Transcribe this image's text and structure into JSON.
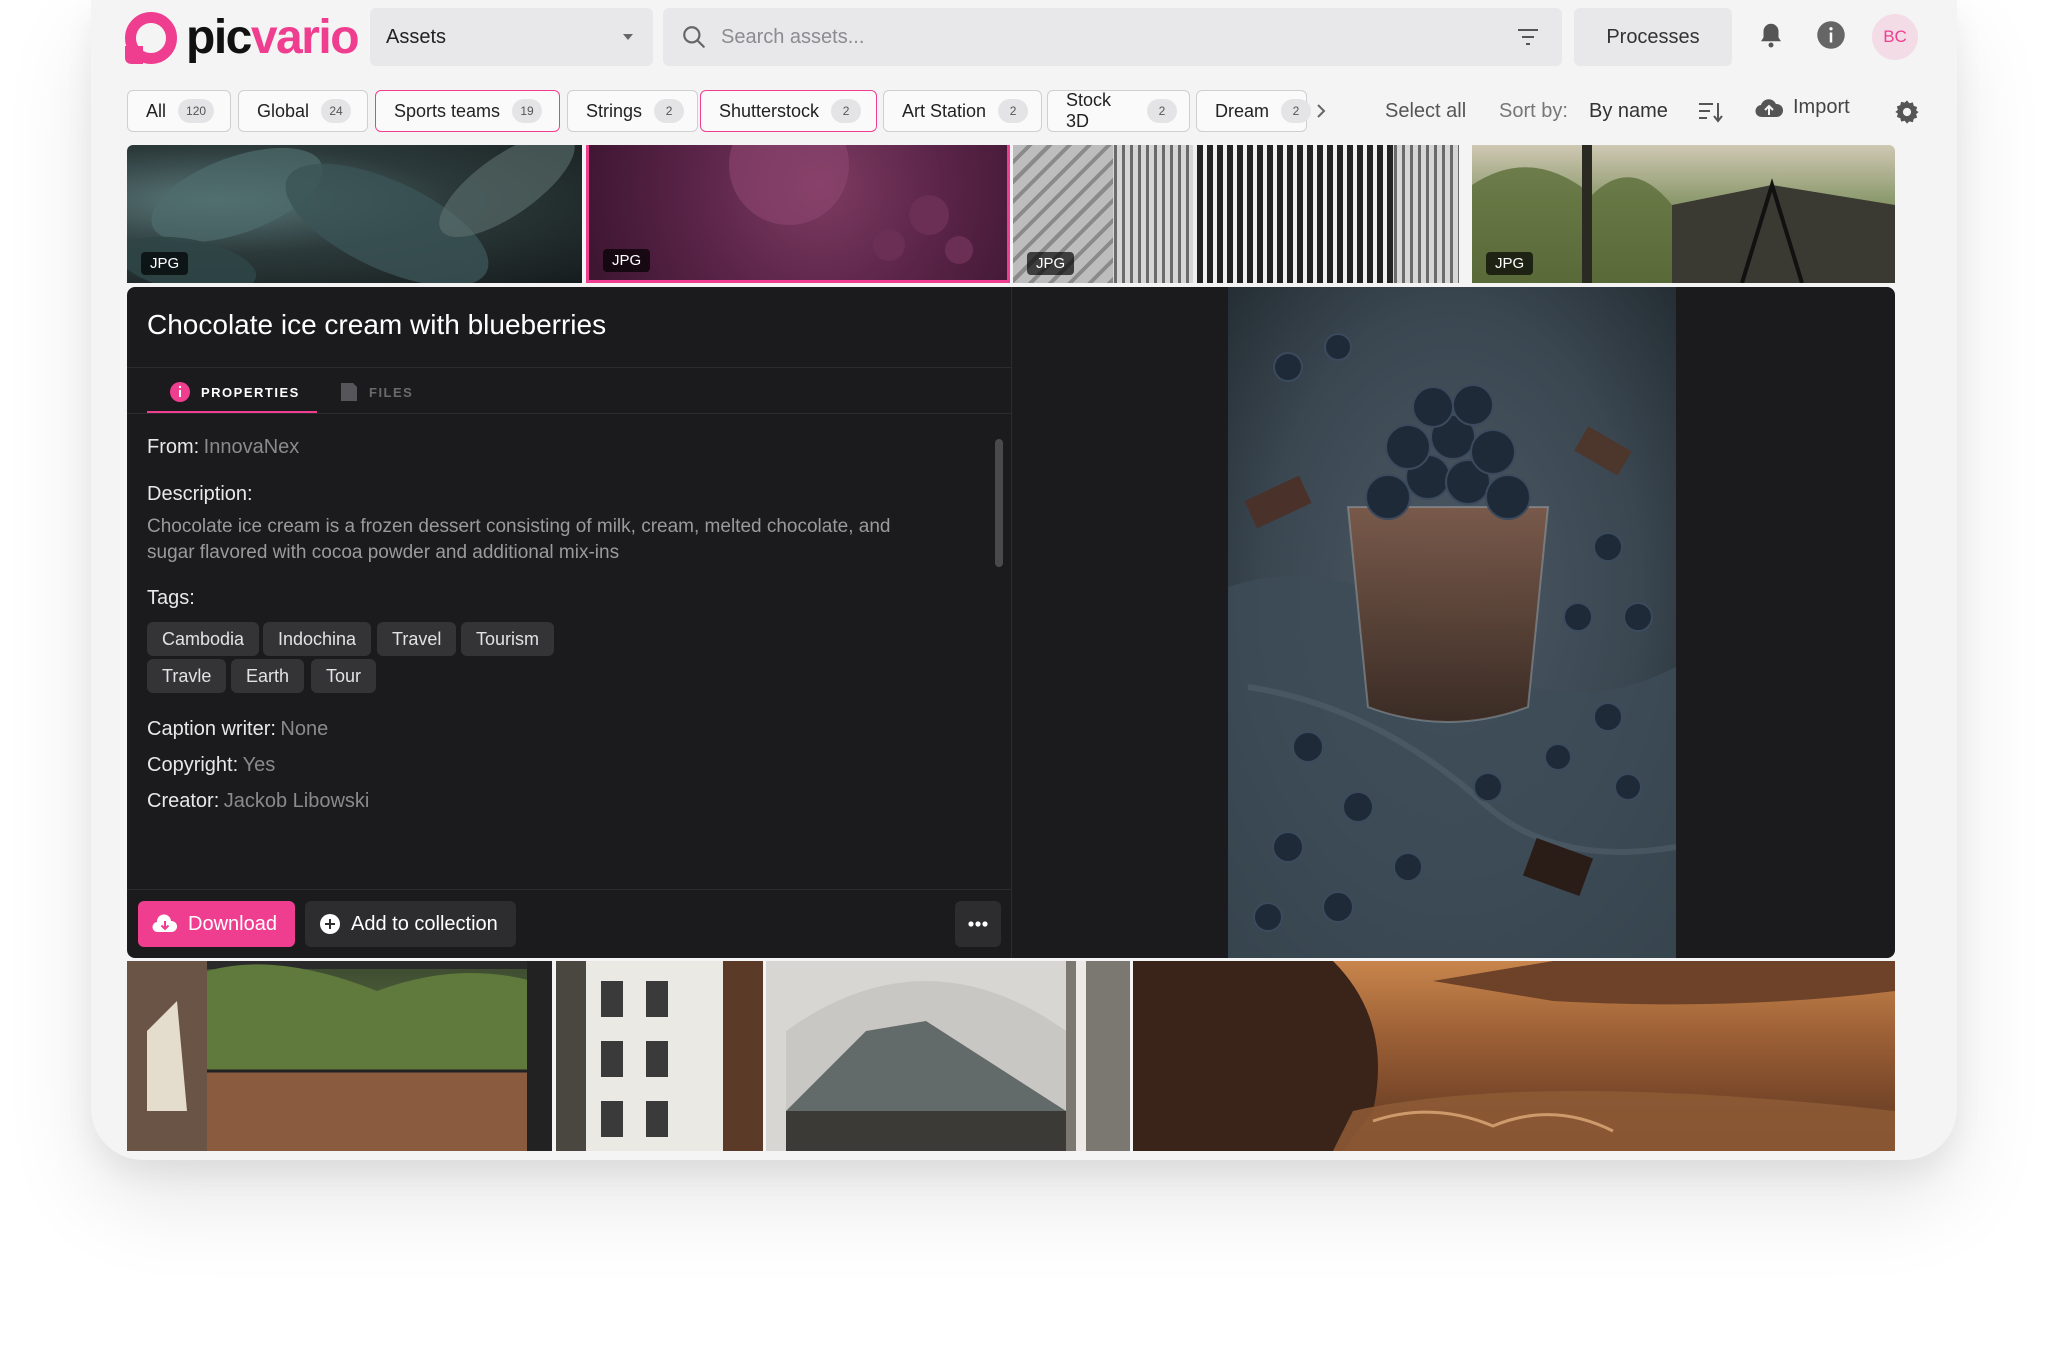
{
  "app": {
    "logo_text_dark": "pic",
    "logo_text_accent": "vario",
    "brand_color": "#ef3e8f"
  },
  "header": {
    "assets_select": "Assets",
    "search_placeholder": "Search assets...",
    "processes_label": "Processes",
    "avatar_initials": "BC"
  },
  "collections": [
    {
      "label": "All",
      "count": "120",
      "active": false
    },
    {
      "label": "Global",
      "count": "24",
      "active": false
    },
    {
      "label": "Sports teams",
      "count": "19",
      "active": true
    },
    {
      "label": "Strings",
      "count": "2",
      "active": false
    },
    {
      "label": "Shutterstock",
      "count": "2",
      "active": true
    },
    {
      "label": "Art Station",
      "count": "2",
      "active": false
    },
    {
      "label": "Stock 3D",
      "count": "2",
      "active": false
    },
    {
      "label": "Dream",
      "count": "2",
      "active": false
    }
  ],
  "toolbar": {
    "select_all": "Select all",
    "sort_label": "Sort by:",
    "sort_value": "By name",
    "import_label": "Import"
  },
  "thumbnails_top": [
    {
      "badge": "JPG",
      "subject": "dark teal leaves"
    },
    {
      "badge": "JPG",
      "subject": "chocolate ice cream (selected, pink tint)"
    },
    {
      "badge": "JPG",
      "subject": "grey facade with vertical slats"
    },
    {
      "badge": "JPG",
      "subject": "terrace with palms"
    }
  ],
  "detail": {
    "title": "Chocolate ice cream with blueberries",
    "tabs": {
      "properties": "PROPERTIES",
      "files": "FILES"
    },
    "from_label": "From:",
    "from_value": "InnovaNex",
    "description_label": "Description:",
    "description": "Chocolate ice cream is a frozen dessert consisting of milk, cream, melted chocolate, and sugar flavored with cocoa powder and additional mix-ins",
    "tags_label": "Tags:",
    "tags": [
      "Cambodia",
      "Indochina",
      "Travel",
      "Tourism",
      "Travle",
      "Earth",
      "Tour"
    ],
    "caption_writer_label": "Caption writer:",
    "caption_writer_value": "None",
    "copyright_label": "Copyright:",
    "copyright_value": "Yes",
    "creator_label": "Creator:",
    "creator_value": "Jackob Libowski",
    "download_label": "Download",
    "add_to_collection_label": "Add to collection"
  },
  "thumbnails_bottom": [
    {
      "subject": "balcony with jungle view"
    },
    {
      "subject": "white building facade"
    },
    {
      "subject": "arch with volcano view"
    },
    {
      "subject": "sunset sea with rocks"
    }
  ],
  "rail_icons": [
    "edit-icon",
    "face-scan-icon",
    "clipboard-icon",
    "clock-icon",
    "comment-icon",
    "link-icon",
    "share-icon",
    "play-icon",
    "upload-cloud-icon",
    "arrow-right-circle-icon"
  ]
}
